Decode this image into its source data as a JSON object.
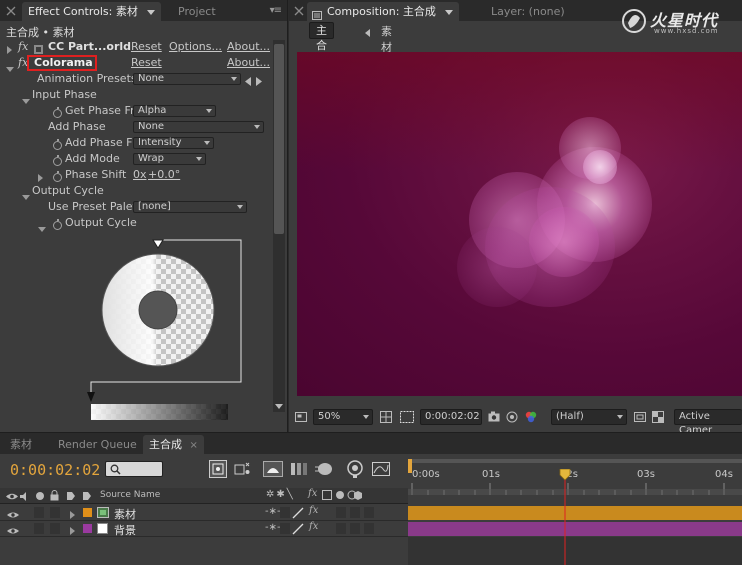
{
  "effect_controls": {
    "tab_label": "Effect Controls: 素材",
    "tab_project": "Project",
    "title": "主合成 • 素材",
    "fx_symbol": "fx",
    "effects": [
      {
        "name": "CC Part...orld",
        "reset": "Reset",
        "options": "Options...",
        "about": "About..."
      },
      {
        "name": "Colorama",
        "reset": "Reset",
        "about": "About..."
      }
    ],
    "animation_presets": {
      "label": "Animation Presets:",
      "value": "None"
    },
    "input_phase": {
      "label": "Input Phase",
      "get_phase": {
        "label": "Get Phase Fr",
        "value": "Alpha"
      },
      "add_phase": {
        "label": "Add Phase",
        "value": "None"
      },
      "add_phase_from": {
        "label": "Add Phase F",
        "value": "Intensity"
      },
      "add_mode": {
        "label": "Add Mode",
        "value": "Wrap"
      },
      "phase_shift": {
        "label": "Phase Shift",
        "value_rev": "0x",
        "value_deg": "+0.0°"
      }
    },
    "output_cycle": {
      "label": "Output Cycle",
      "use_preset": {
        "label": "Use Preset Palet",
        "value": "[none]"
      },
      "output_cycle_item": {
        "label": "Output Cycle"
      }
    }
  },
  "composition": {
    "tab_label": "Composition: 主合成",
    "tab_layer": "Layer: (none)",
    "flow": [
      "主合成",
      "素材"
    ],
    "footer": {
      "zoom": "50%",
      "timecode": "0:00:02:02",
      "resolution": "(Half)",
      "camera": "Active Camer"
    },
    "background_color": "#5a0a3a"
  },
  "logo": {
    "text": "火星时代",
    "url_text": "www.hxsd.com"
  },
  "timeline": {
    "tabs": [
      "素材",
      "Render Queue",
      "主合成"
    ],
    "current_time": "0:00:02:02",
    "source_name_header": "Source Name",
    "layers": [
      {
        "number": "1",
        "name": "素材",
        "color": "#e0901a",
        "bar_color": "#c98a1e"
      },
      {
        "number": "2",
        "name": "背景",
        "color": "#9a3aa0",
        "bar_color": "#8a3a8a"
      }
    ],
    "ruler_labels": [
      "0:00s",
      "01s",
      "02s",
      "03s",
      "04s"
    ],
    "playhead_fraction": 0.49
  }
}
